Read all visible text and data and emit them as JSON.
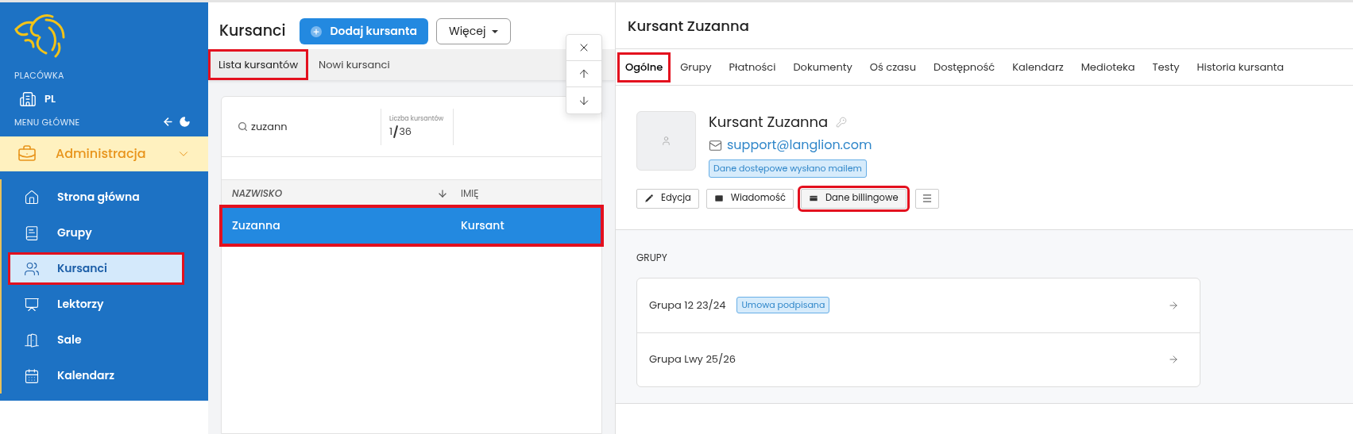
{
  "sidebar": {
    "section_label": "PLACÓWKA",
    "branch": "PL",
    "menu_label": "MENU GŁÓWNE",
    "group": {
      "label": "Administracja",
      "expanded": true
    },
    "items": [
      {
        "label": "Strona główna",
        "selected": false,
        "highlighted": false
      },
      {
        "label": "Grupy",
        "selected": false,
        "highlighted": false
      },
      {
        "label": "Kursanci",
        "selected": true,
        "highlighted": true
      },
      {
        "label": "Lektorzy",
        "selected": false,
        "highlighted": false
      },
      {
        "label": "Sale",
        "selected": false,
        "highlighted": false
      },
      {
        "label": "Kalendarz",
        "selected": false,
        "highlighted": false
      }
    ]
  },
  "list_panel": {
    "title": "Kursanci",
    "add_button": "Dodaj kursanta",
    "more_button": "Więcej",
    "tabs": [
      {
        "label": "Lista kursantów",
        "selected": true,
        "highlighted": true
      },
      {
        "label": "Nowi kursanci",
        "selected": false,
        "highlighted": false
      }
    ],
    "search": {
      "value": "zuzann"
    },
    "counter": {
      "label": "Liczba kursantów",
      "shown": "1",
      "total": "36"
    },
    "table": {
      "columns": [
        {
          "label": "NAZWISKO",
          "sorted": true
        },
        {
          "label": "IMIĘ",
          "sorted": false
        }
      ],
      "rows": [
        {
          "cells": [
            "Zuzanna",
            "Kursant"
          ],
          "selected": true,
          "highlighted": true
        }
      ]
    }
  },
  "detail": {
    "title": "Kursant Zuzanna",
    "tabs": [
      {
        "label": "Ogólne",
        "selected": true,
        "highlighted": true
      },
      {
        "label": "Grupy",
        "selected": false,
        "highlighted": false
      },
      {
        "label": "Płatności",
        "selected": false,
        "highlighted": false
      },
      {
        "label": "Dokumenty",
        "selected": false,
        "highlighted": false
      },
      {
        "label": "Oś czasu",
        "selected": false,
        "highlighted": false
      },
      {
        "label": "Dostępność",
        "selected": false,
        "highlighted": false
      },
      {
        "label": "Kalendarz",
        "selected": false,
        "highlighted": false
      },
      {
        "label": "Medioteka",
        "selected": false,
        "highlighted": false
      },
      {
        "label": "Testy",
        "selected": false,
        "highlighted": false
      },
      {
        "label": "Historia kursanta",
        "selected": false,
        "highlighted": false
      }
    ],
    "profile": {
      "name": "Kursant Zuzanna",
      "email": "support@langlion.com",
      "badge": "Dane dostępowe wysłano mailem"
    },
    "actions": [
      {
        "label": "Edycja",
        "highlighted": false
      },
      {
        "label": "Wiadomość",
        "highlighted": false
      },
      {
        "label": "Dane billingowe",
        "highlighted": true
      }
    ],
    "groups": {
      "title": "GRUPY",
      "items": [
        {
          "name": "Grupa 12 23/24",
          "badge": "Umowa podpisana"
        },
        {
          "name": "Grupa Lwy 25/26"
        }
      ]
    }
  }
}
